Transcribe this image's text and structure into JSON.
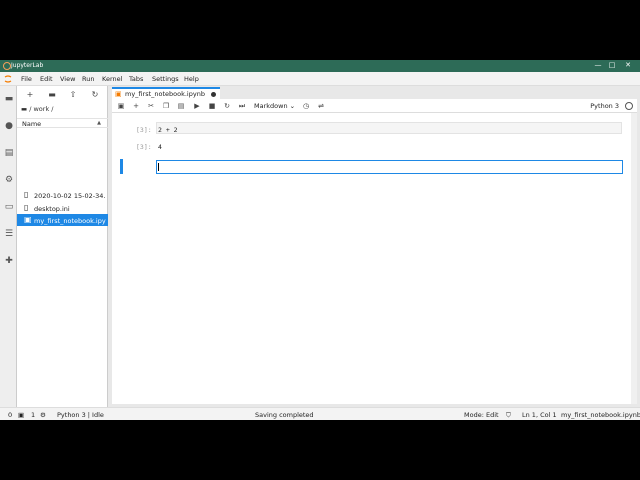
{
  "window": {
    "title": "JupyterLab",
    "controls": {
      "minimize": "—",
      "maximize": "□",
      "close": "✕"
    }
  },
  "menubar": {
    "items": [
      "File",
      "Edit",
      "View",
      "Run",
      "Kernel",
      "Tabs",
      "Settings",
      "Help"
    ]
  },
  "leftbar": {
    "icons": [
      "folder-icon",
      "running-icon",
      "commands-icon",
      "property-inspector-icon",
      "tabs-icon",
      "toc-icon",
      "extension-icon"
    ]
  },
  "filebrowser": {
    "breadcrumb": "/ work /",
    "column_name": "Name",
    "files": [
      {
        "name": "2020-10-02 15-02-34....",
        "selected": false
      },
      {
        "name": "desktop.ini",
        "selected": false
      },
      {
        "name": "my_first_notebook.ipynb",
        "selected": true
      }
    ]
  },
  "tab": {
    "label": "my_first_notebook.ipynb"
  },
  "notebook": {
    "cell_type": "Markdown",
    "kernel": "Python 3",
    "cells": [
      {
        "prompt": "[3]:",
        "source": "2 + 2"
      },
      {
        "prompt": "[3]:",
        "output": "4"
      }
    ]
  },
  "statusbar": {
    "count0": "0",
    "count1": "1",
    "kernel_status": "Python 3 | Idle",
    "message": "Saving completed",
    "mode": "Mode: Edit",
    "position": "Ln 1, Col 1",
    "filename": "my_first_notebook.ipynb"
  },
  "colors": {
    "accent": "#1e88e5",
    "titlebar": "#2d6b57"
  }
}
